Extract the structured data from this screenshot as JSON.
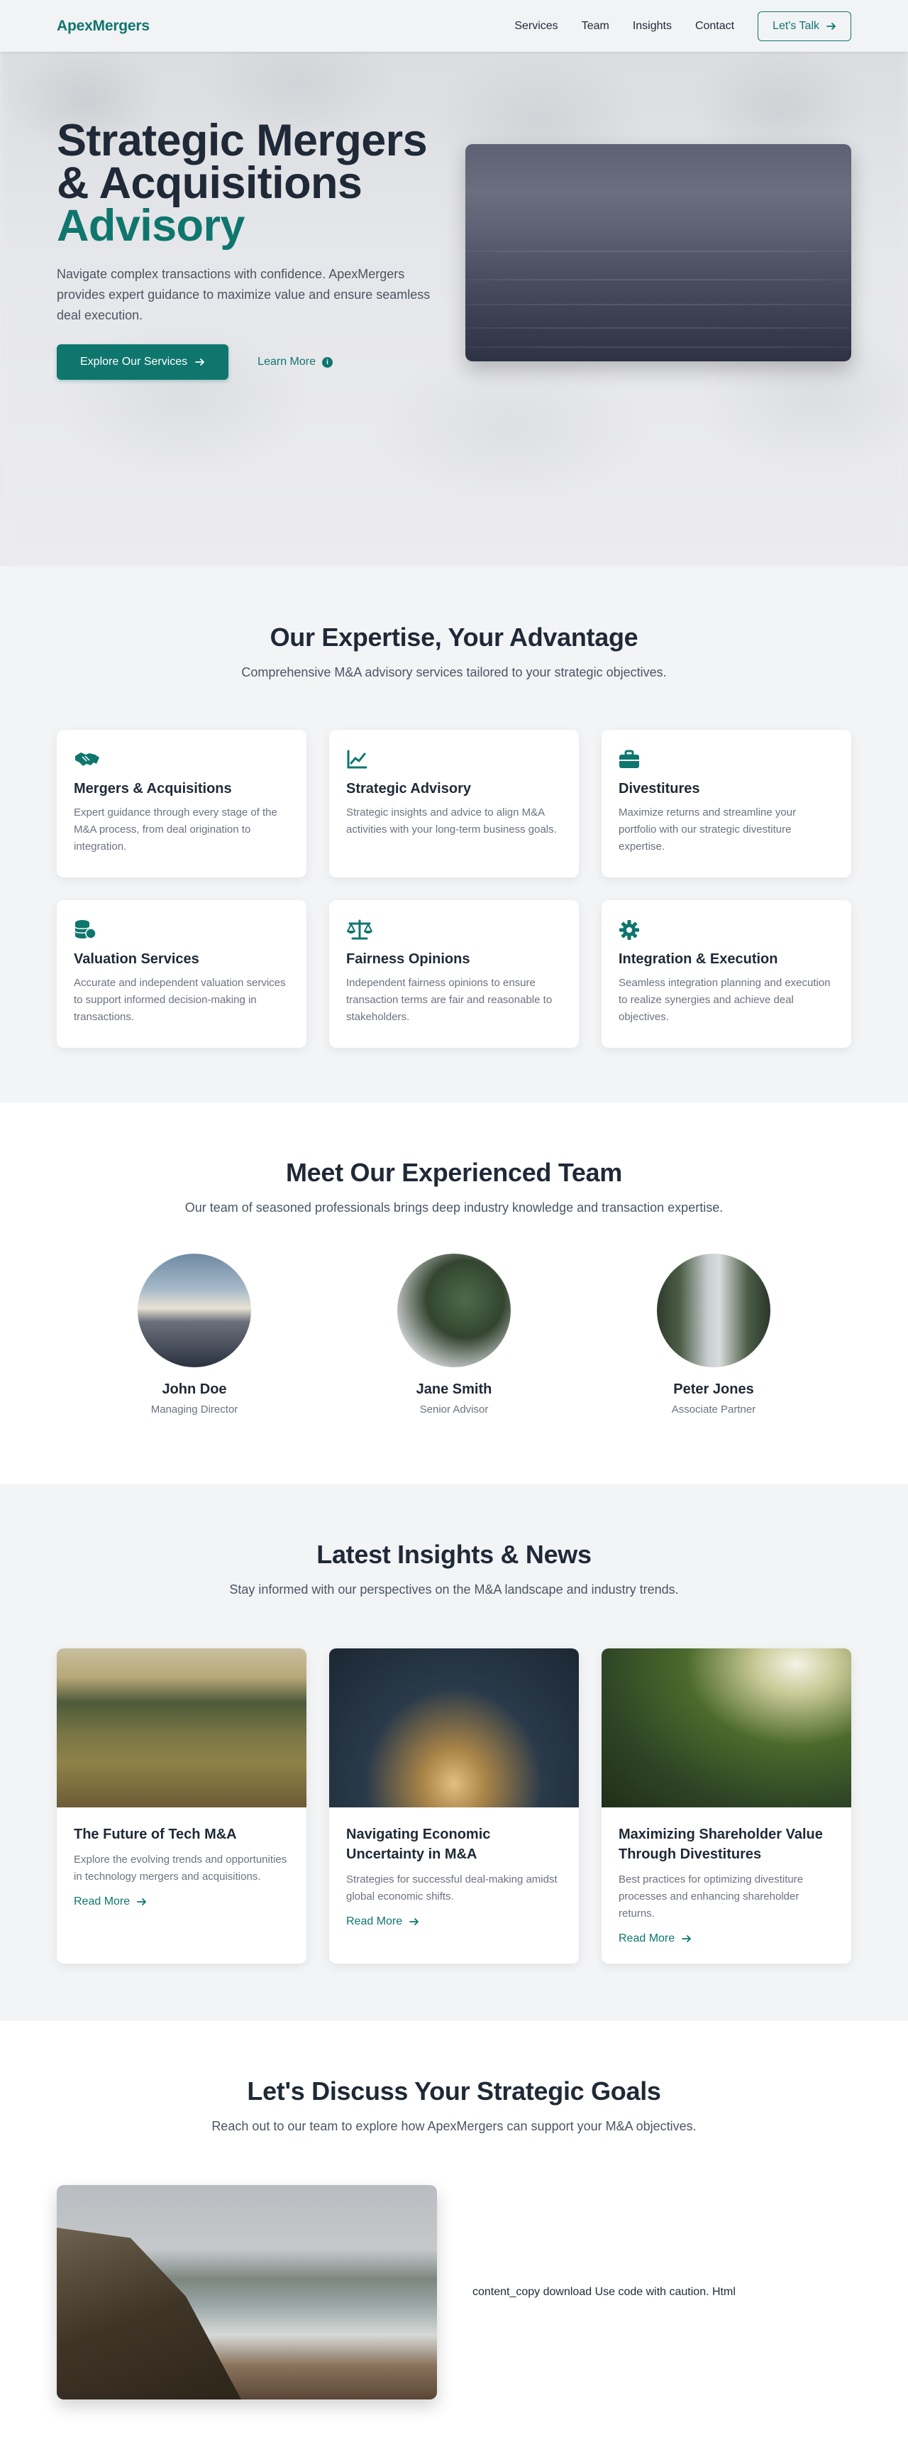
{
  "nav": {
    "brand": "ApexMergers",
    "links": [
      "Services",
      "Team",
      "Insights",
      "Contact"
    ],
    "cta": "Let's Talk"
  },
  "hero": {
    "title_line1": "Strategic Mergers",
    "title_line2": "& Acquisitions",
    "title_accent": "Advisory",
    "subtitle": "Navigate complex transactions with confidence. ApexMergers provides expert guidance to maximize value and ensure seamless deal execution.",
    "primary_button": "Explore Our Services",
    "secondary_link": "Learn More"
  },
  "expertise": {
    "title": "Our Expertise, Your Advantage",
    "subtitle": "Comprehensive M&A advisory services tailored to your strategic objectives.",
    "cards": [
      {
        "icon": "handshake-icon",
        "title": "Mergers & Acquisitions",
        "desc": "Expert guidance through every stage of the M&A process, from deal origination to integration."
      },
      {
        "icon": "chart-line-icon",
        "title": "Strategic Advisory",
        "desc": "Strategic insights and advice to align M&A activities with your long-term business goals."
      },
      {
        "icon": "briefcase-icon",
        "title": "Divestitures",
        "desc": "Maximize returns and streamline your portfolio with our strategic divestiture expertise."
      },
      {
        "icon": "coins-icon",
        "title": "Valuation Services",
        "desc": "Accurate and independent valuation services to support informed decision-making in transactions."
      },
      {
        "icon": "balance-scale-icon",
        "title": "Fairness Opinions",
        "desc": "Independent fairness opinions to ensure transaction terms are fair and reasonable to stakeholders."
      },
      {
        "icon": "gear-icon",
        "title": "Integration & Execution",
        "desc": "Seamless integration planning and execution to realize synergies and achieve deal objectives."
      }
    ]
  },
  "team": {
    "title": "Meet Our Experienced Team",
    "subtitle": "Our team of seasoned professionals brings deep industry knowledge and transaction expertise.",
    "members": [
      {
        "name": "John Doe",
        "role": "Managing Director"
      },
      {
        "name": "Jane Smith",
        "role": "Senior Advisor"
      },
      {
        "name": "Peter Jones",
        "role": "Associate Partner"
      }
    ]
  },
  "insights": {
    "title": "Latest Insights & News",
    "subtitle": "Stay informed with our perspectives on the M&A landscape and industry trends.",
    "posts": [
      {
        "title": "The Future of Tech M&A",
        "desc": "Explore the evolving trends and opportunities in technology mergers and acquisitions.",
        "link": "Read More"
      },
      {
        "title": "Navigating Economic Uncertainty in M&A",
        "desc": "Strategies for successful deal-making amidst global economic shifts.",
        "link": "Read More"
      },
      {
        "title": "Maximizing Shareholder Value Through Divestitures",
        "desc": "Best practices for optimizing divestiture processes and enhancing shareholder returns.",
        "link": "Read More"
      }
    ]
  },
  "contact": {
    "title": "Let's Discuss Your Strategic Goals",
    "subtitle": "Reach out to our team to explore how ApexMergers can support your M&A objectives.",
    "note": "content_copy download Use code with caution. Html"
  },
  "colors": {
    "brand": "#0f766e",
    "text": "#1f2937",
    "muted": "#6b7280",
    "section_bg": "#f3f4f6"
  }
}
